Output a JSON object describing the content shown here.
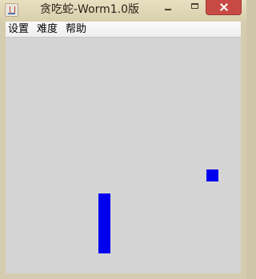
{
  "window": {
    "title": "贪吃蛇-Worm1.0版",
    "minimize_icon": "minimize-icon",
    "maximize_icon": "maximize-icon",
    "close_icon": "close-icon",
    "app_icon": "java-coffee-cup-icon"
  },
  "menu": {
    "items": [
      {
        "label": "设置"
      },
      {
        "label": "难度"
      },
      {
        "label": "帮助"
      }
    ]
  },
  "game": {
    "background_color": "#d4d4d4",
    "snake_color": "#0000ee",
    "food_color": "#0000ee"
  }
}
